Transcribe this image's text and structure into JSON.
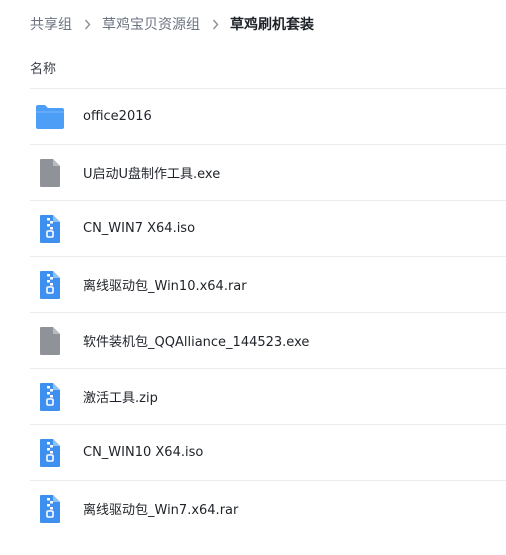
{
  "breadcrumb": {
    "items": [
      "共享组",
      "草鸡宝贝资源组",
      "草鸡刷机套装"
    ]
  },
  "list_header": {
    "name_label": "名称"
  },
  "colors": {
    "folder": "#4d9ef7",
    "archive": "#3d8ff0",
    "generic_file": "#8f9399",
    "divider": "#ececec"
  },
  "files": [
    {
      "name": "office2016",
      "type": "folder-icon"
    },
    {
      "name": "U启动U盘制作工具.exe",
      "type": "file-icon"
    },
    {
      "name": "CN_WIN7 X64.iso",
      "type": "archive-icon"
    },
    {
      "name": "离线驱动包_Win10.x64.rar",
      "type": "archive-icon"
    },
    {
      "name": "软件装机包_QQAlliance_144523.exe",
      "type": "file-icon"
    },
    {
      "name": "激活工具.zip",
      "type": "archive-icon"
    },
    {
      "name": "CN_WIN10 X64.iso",
      "type": "archive-icon"
    },
    {
      "name": "离线驱动包_Win7.x64.rar",
      "type": "archive-icon"
    }
  ]
}
